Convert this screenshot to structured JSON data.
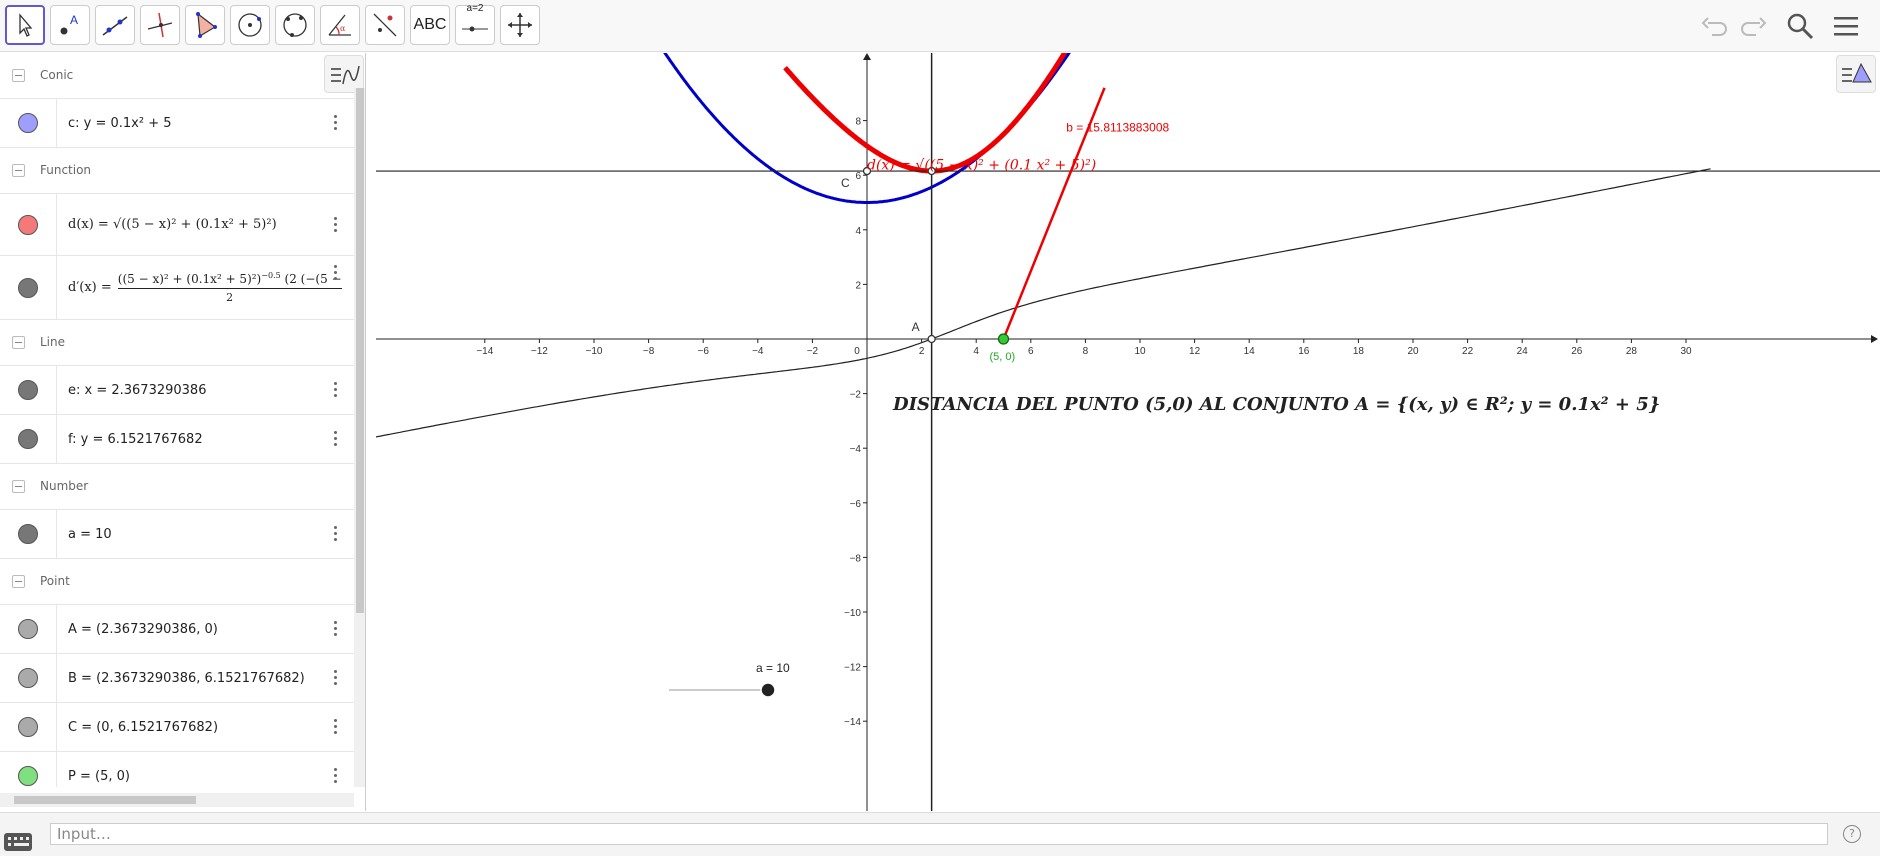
{
  "toolbar": {
    "tools": [
      {
        "name": "move-tool",
        "label": ""
      },
      {
        "name": "point-tool",
        "label": ""
      },
      {
        "name": "line-tool",
        "label": ""
      },
      {
        "name": "perpendicular-tool",
        "label": ""
      },
      {
        "name": "polygon-tool",
        "label": ""
      },
      {
        "name": "circle-tool",
        "label": ""
      },
      {
        "name": "circle-three-points-tool",
        "label": ""
      },
      {
        "name": "angle-tool",
        "label": ""
      },
      {
        "name": "reflect-tool",
        "label": ""
      },
      {
        "name": "text-tool",
        "label": "ABC"
      },
      {
        "name": "slider-tool",
        "label": "a=2"
      },
      {
        "name": "move-graphics-tool",
        "label": ""
      }
    ]
  },
  "algebra": {
    "groups": [
      {
        "name": "Conic",
        "items": [
          {
            "expr": "c: y = 0.1x² + 5",
            "color": "#9e9efc"
          }
        ]
      },
      {
        "name": "Function",
        "items": [
          {
            "expr": "d(x) = √((5 − x)² + (0.1x² + 5)²)",
            "color": "#f47a7a"
          },
          {
            "expr": "d′(x) =",
            "color": "#666666"
          }
        ]
      },
      {
        "name": "Line",
        "items": [
          {
            "expr": "e: x = 2.3673290386",
            "color": "#666666"
          },
          {
            "expr": "f: y = 6.1521767682",
            "color": "#666666"
          }
        ]
      },
      {
        "name": "Number",
        "items": [
          {
            "expr": "a = 10",
            "color": "#666666"
          }
        ]
      },
      {
        "name": "Point",
        "items": [
          {
            "expr": "A = (2.3673290386, 0)",
            "color": "#999999"
          },
          {
            "expr": "B = (2.3673290386, 6.1521767682)",
            "color": "#999999"
          },
          {
            "expr": "C = (0, 6.1521767682)",
            "color": "#999999"
          },
          {
            "expr": "P = (5, 0)",
            "color": "#7fe07f"
          }
        ]
      }
    ],
    "deriv_num": "((5 − x)² + (0.1x² + 5)²)",
    "deriv_exp": "−0.5",
    "deriv_tail": "(2 (−(5 −",
    "deriv_den": "2"
  },
  "graphics": {
    "title_text": "DISTANCIA DEL PUNTO (5,0) AL CONJUNTO A = {(x, y) ∈ R²; y = 0.1x² + 5}",
    "b_label": "b = 15.8113883008",
    "p_label": "(5, 0)",
    "point_A_label": "A",
    "point_C_label": "C",
    "slider_label": "a = 10",
    "d_label": "d(x) = √((5 − x)² + (0.1 x² + 5)²)",
    "x_ticks": [
      "−14",
      "−12",
      "−10",
      "−8",
      "−6",
      "−4",
      "−2",
      "0",
      "2",
      "4",
      "6",
      "8",
      "10",
      "12",
      "14",
      "16",
      "18",
      "20",
      "22",
      "24",
      "26",
      "28",
      "30"
    ],
    "y_ticks": [
      "8",
      "6",
      "4",
      "2",
      "−2",
      "−4",
      "−6",
      "−8",
      "−10",
      "−12",
      "−14"
    ],
    "colors": {
      "conic": "#0000cc",
      "function": "#ee0000",
      "point_p": "#33cc33",
      "axis": "#222222"
    }
  },
  "input": {
    "placeholder": "Input…"
  },
  "help_label": "?"
}
